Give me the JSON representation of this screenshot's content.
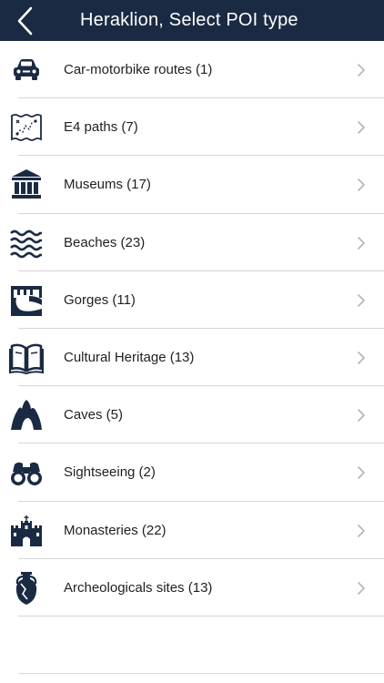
{
  "header": {
    "title": "Heraklion, Select POI type",
    "back_icon": "chevron-left-icon"
  },
  "colors": {
    "navbar": "#1b2a43",
    "icon": "#1b2a43",
    "chevron": "#b5b5b5",
    "divider": "#d6d6d6"
  },
  "items": [
    {
      "label": "Car-motorbike routes (1)",
      "icon": "car-icon"
    },
    {
      "label": "E4 paths (7)",
      "icon": "map-icon"
    },
    {
      "label": "Museums (17)",
      "icon": "museum-icon"
    },
    {
      "label": "Beaches (23)",
      "icon": "waves-icon"
    },
    {
      "label": "Gorges (11)",
      "icon": "gorge-icon"
    },
    {
      "label": "Cultural Heritage (13)",
      "icon": "book-icon"
    },
    {
      "label": "Caves (5)",
      "icon": "cave-icon"
    },
    {
      "label": "Sightseeing (2)",
      "icon": "binoculars-icon"
    },
    {
      "label": "Monasteries (22)",
      "icon": "monastery-icon"
    },
    {
      "label": "Archeologicals sites (13)",
      "icon": "amphora-icon"
    }
  ]
}
